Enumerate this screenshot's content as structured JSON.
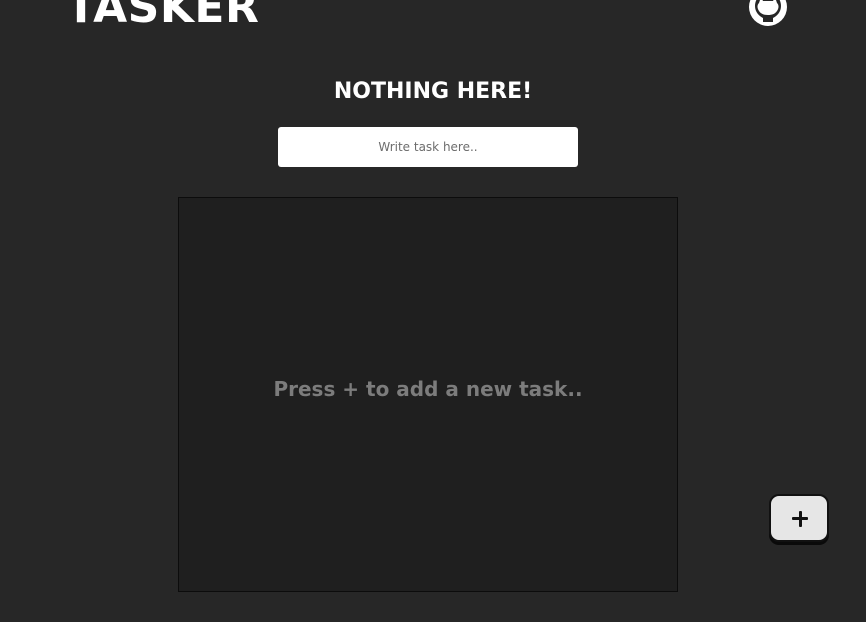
{
  "header": {
    "brand": "TASKER",
    "github_icon": "github-icon"
  },
  "main": {
    "status_heading": "NOTHING HERE!",
    "task_input": {
      "value": "",
      "placeholder": "Write task here.."
    },
    "task_list": {
      "items": [],
      "empty_hint": "Press + to add a new task.."
    },
    "add_button": {
      "icon": "plus-icon"
    }
  },
  "colors": {
    "background": "#272727",
    "panel": "#1f1f1f",
    "text": "#ffffff",
    "hint_text": "#7c7c7c",
    "button": "#e6e6e6"
  }
}
